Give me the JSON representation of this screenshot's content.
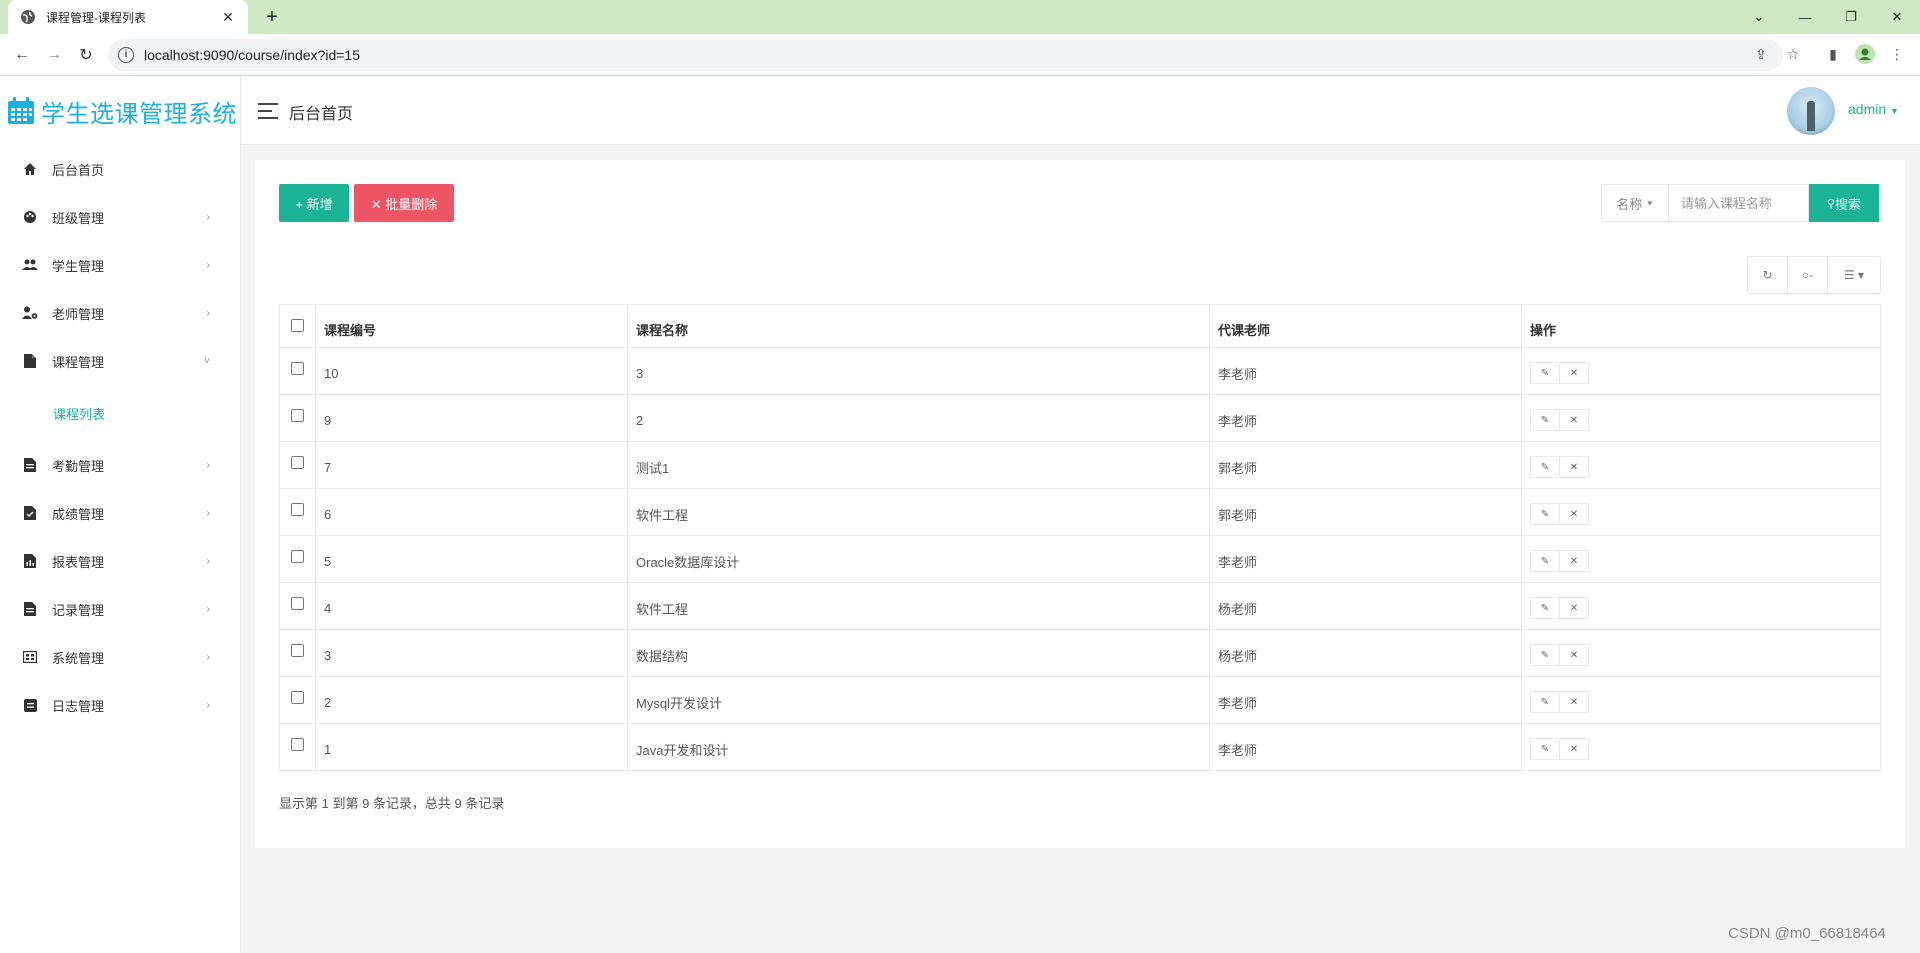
{
  "browser": {
    "tab_title": "课程管理-课程列表",
    "url": "localhost:9090/course/index?id=15"
  },
  "app": {
    "brand": "学生选课管理系统",
    "breadcrumb": "后台首页",
    "user": "admin",
    "accent": "#1ab394",
    "danger": "#ed5565",
    "brand_color": "#1ab1e0"
  },
  "sidebar": {
    "items": [
      {
        "label": "后台首页",
        "icon": "home-icon"
      },
      {
        "label": "班级管理",
        "icon": "palette-icon",
        "arrow": "›"
      },
      {
        "label": "学生管理",
        "icon": "users-icon",
        "arrow": "›"
      },
      {
        "label": "老师管理",
        "icon": "user-gear-icon",
        "arrow": "›"
      },
      {
        "label": "课程管理",
        "icon": "file-icon",
        "arrow": "˅"
      },
      {
        "label": "考勤管理",
        "icon": "file-text-icon",
        "arrow": "›"
      },
      {
        "label": "成绩管理",
        "icon": "file-check-icon",
        "arrow": "›"
      },
      {
        "label": "报表管理",
        "icon": "file-chart-icon",
        "arrow": "›"
      },
      {
        "label": "记录管理",
        "icon": "file-text-icon",
        "arrow": "›"
      },
      {
        "label": "系统管理",
        "icon": "grid-icon",
        "arrow": "›"
      },
      {
        "label": "日志管理",
        "icon": "log-icon",
        "arrow": "›"
      }
    ],
    "submenu_active": "课程列表"
  },
  "toolbar": {
    "add_label": "+ 新增",
    "batch_delete_label": "✕ 批量删除",
    "search_field": "名称",
    "search_placeholder": "请输入课程名称",
    "search_label": "搜索"
  },
  "table": {
    "columns": [
      "课程编号",
      "课程名称",
      "代课老师",
      "操作"
    ],
    "rows": [
      {
        "id": "10",
        "name": "3",
        "teacher": "李老师"
      },
      {
        "id": "9",
        "name": "2",
        "teacher": "李老师"
      },
      {
        "id": "7",
        "name": "测试1",
        "teacher": "郭老师"
      },
      {
        "id": "6",
        "name": "软件工程",
        "teacher": "郭老师"
      },
      {
        "id": "5",
        "name": "Oracle数据库设计",
        "teacher": "李老师"
      },
      {
        "id": "4",
        "name": "软件工程",
        "teacher": "杨老师"
      },
      {
        "id": "3",
        "name": "数据结构",
        "teacher": "杨老师"
      },
      {
        "id": "2",
        "name": "Mysql开发设计",
        "teacher": "李老师"
      },
      {
        "id": "1",
        "name": "Java开发和设计",
        "teacher": "李老师"
      }
    ],
    "summary": "显示第 1 到第 9 条记录，总共 9 条记录"
  },
  "watermark": "CSDN @m0_66818464"
}
